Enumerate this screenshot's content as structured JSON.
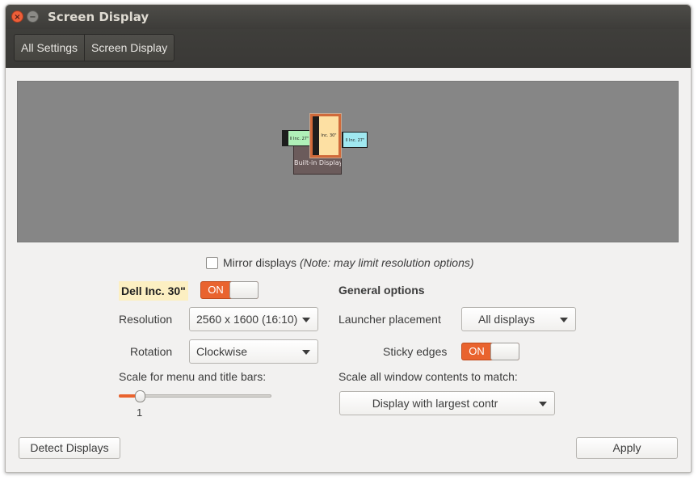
{
  "window": {
    "title": "Screen Display",
    "close_glyph": "×",
    "minimize_glyph": "−"
  },
  "breadcrumbs": [
    {
      "label": "All Settings"
    },
    {
      "label": "Screen Display"
    }
  ],
  "preview": {
    "monitors": {
      "left_label": "ll Inc. 27\"",
      "main_label": "Inc. 30\"",
      "right_label": "ll Inc. 27\"",
      "builtin_label": "Built-in Display"
    }
  },
  "mirror": {
    "label": "Mirror displays",
    "note": "(Note: may limit resolution options)",
    "checked": false
  },
  "display": {
    "name": "Dell Inc. 30\"",
    "toggle_label": "ON",
    "enabled": true,
    "resolution_label": "Resolution",
    "resolution_value": "2560 x 1600 (16:10)",
    "rotation_label": "Rotation",
    "rotation_value": "Clockwise",
    "scale_label": "Scale for menu and title bars:",
    "scale_value": "1"
  },
  "general": {
    "heading": "General options",
    "launcher_label": "Launcher placement",
    "launcher_value": "All displays",
    "sticky_label": "Sticky edges",
    "sticky_toggle_label": "ON",
    "sticky_enabled": true,
    "scale_all_label": "Scale all window contents to match:",
    "scale_all_value": "Display with largest contr"
  },
  "buttons": {
    "detect": "Detect Displays",
    "apply": "Apply"
  },
  "colors": {
    "accent": "#e9632e",
    "highlight": "#fcefc2",
    "titlebar": "#3d3c39",
    "preview_bg": "#868686"
  }
}
